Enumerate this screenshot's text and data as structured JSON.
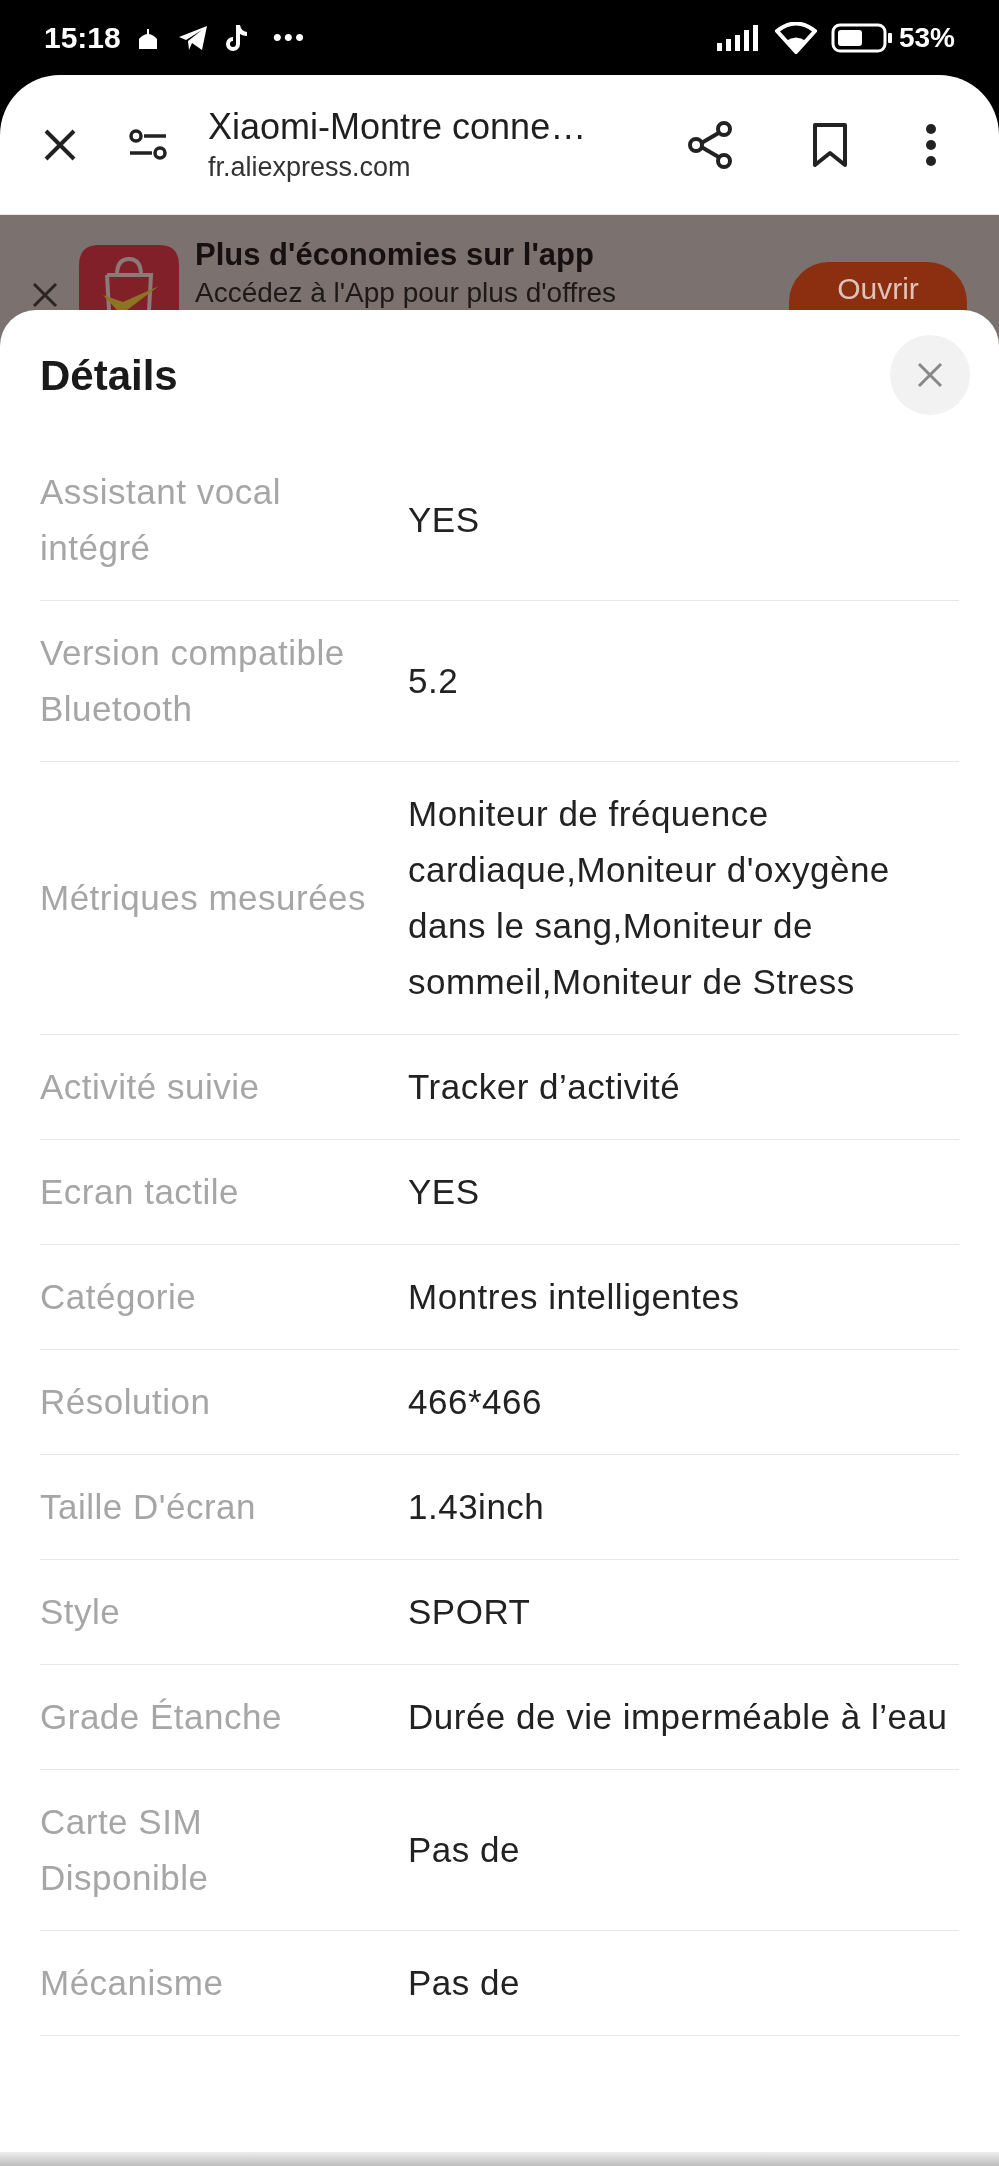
{
  "status_bar": {
    "time": "15:18",
    "more": "•••",
    "battery": "53%"
  },
  "browser": {
    "title": "Xiaomi-Montre conne…",
    "url": "fr.aliexpress.com"
  },
  "banner": {
    "title": "Plus d'économies sur l'app",
    "subtitle": "Accédez à l'App pour plus d'offres",
    "button": "Ouvrir"
  },
  "sheet": {
    "title": "Détails",
    "rows": [
      {
        "label": "Assistant vocal intégré",
        "value": "YES"
      },
      {
        "label": "Version compatible Bluetooth",
        "value": "5.2"
      },
      {
        "label": "Métriques mesurées",
        "value": "Moniteur de fréquence cardiaque,Moniteur d'oxygène dans le sang,Moniteur de sommeil,Moniteur de Stress"
      },
      {
        "label": "Activité suivie",
        "value": "Tracker d’activité"
      },
      {
        "label": "Ecran tactile",
        "value": "YES"
      },
      {
        "label": "Catégorie",
        "value": "Montres intelligentes"
      },
      {
        "label": "Résolution",
        "value": "466*466"
      },
      {
        "label": "Taille D'écran",
        "value": "1.43inch"
      },
      {
        "label": "Style",
        "value": "SPORT"
      },
      {
        "label": "Grade Étanche",
        "value": "Durée de vie imperméable à l’eau"
      },
      {
        "label": "Carte SIM Disponible",
        "value": "Pas de"
      },
      {
        "label": "Mécanisme",
        "value": "Pas de"
      }
    ]
  }
}
